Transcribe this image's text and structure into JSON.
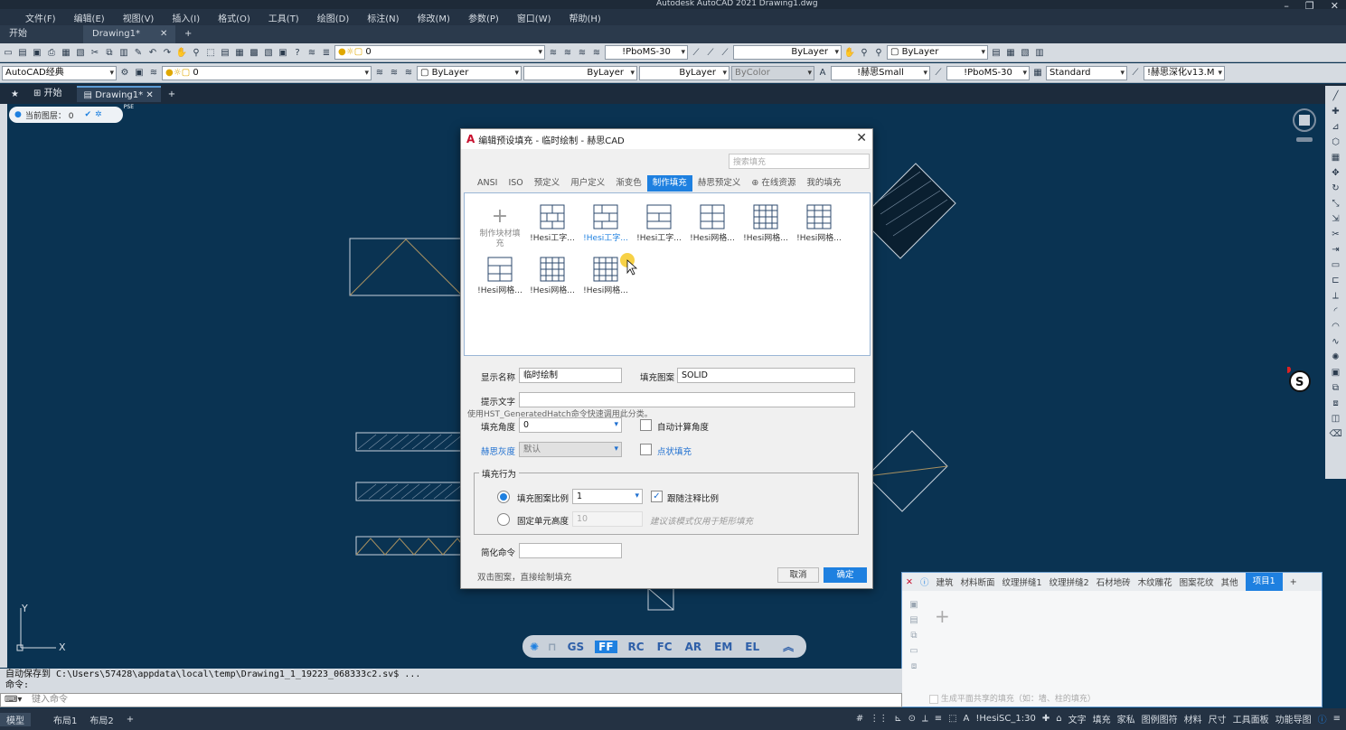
{
  "title_bar": {
    "text": "Autodesk AutoCAD 2021    Drawing1.dwg"
  },
  "menu": [
    "文件(F)",
    "编辑(E)",
    "视图(V)",
    "插入(I)",
    "格式(O)",
    "工具(T)",
    "绘图(D)",
    "标注(N)",
    "修改(M)",
    "参数(P)",
    "窗口(W)",
    "帮助(H)"
  ],
  "doc_tabs": [
    "开始",
    "Drawing1*"
  ],
  "toolbar1": {
    "layer": "0",
    "textstyle": "!PboMS-30",
    "linetype": "ByLayer",
    "color": "ByLayer"
  },
  "toolbar2": {
    "workspace": "AutoCAD经典",
    "layer": "0",
    "color": "ByLayer",
    "linetype": "ByLayer",
    "lineweight": "ByLayer",
    "plotstyle": "ByColor",
    "textstyle": "!赫思Small",
    "dimstyle": "!PboMS-30",
    "tablestyle": "Standard",
    "mleader": "!赫思深化v13.M"
  },
  "drawing_tabs": {
    "start": "开始",
    "drawing": "Drawing1*"
  },
  "layer_pill": {
    "label": "当前图层： 0",
    "pse": "PSE"
  },
  "dialog": {
    "title": "编辑预设填充 - 临时绘制 - 赫思CAD",
    "search_placeholder": "搜索填充",
    "tabs": [
      "ANSI",
      "ISO",
      "预定义",
      "用户定义",
      "渐变色",
      "制作填充",
      "赫思预定义",
      "在线资源",
      "我的填充"
    ],
    "make_block": "制作块材填充",
    "patterns": [
      "!Hesi工字...",
      "!Hesi工字...",
      "!Hesi工字...",
      "!Hesi网格...",
      "!Hesi网格...",
      "!Hesi网格...",
      "!Hesi网格...",
      "!Hesi网格...",
      "!Hesi网格..."
    ],
    "gallery_hint": "使用HST_GeneratedHatch命令快速调用此分类。",
    "display_name_label": "显示名称",
    "display_name": "临时绘制",
    "pattern_label": "填充图案",
    "pattern": "SOLID",
    "tip_label": "提示文字",
    "angle_label": "填充角度",
    "angle": "0",
    "auto_angle": "自动计算角度",
    "gray_label": "赫思灰度",
    "gray": "默认",
    "dot_fill": "点状填充",
    "behavior_title": "填充行为",
    "scale_label": "填充图案比例",
    "scale": "1",
    "follow_scale": "跟随注释比例",
    "fixed_label": "固定单元高度",
    "fixed_value": "10",
    "fixed_hint": "建议该模式仅用于矩形填充",
    "shortcut_label": "简化命令",
    "footer_hint": "双击图案，直接绘制填充",
    "cancel": "取消",
    "ok": "确定"
  },
  "quickbar": [
    "GS",
    "FF",
    "RC",
    "FC",
    "AR",
    "EM",
    "EL"
  ],
  "command": {
    "history": "自动保存到 C:\\Users\\57428\\appdata\\local\\temp\\Drawing1_1_19223_068333c2.sv$ ...",
    "prompt": "命令:",
    "placeholder": "键入命令"
  },
  "status_tabs": [
    "模型",
    "布局1",
    "布局2"
  ],
  "status_right": {
    "scale": "!HesiSC_1:30",
    "items": [
      "文字",
      "填充",
      "家私",
      "图例图符",
      "材料",
      "尺寸",
      "工具面板",
      "功能导图"
    ]
  },
  "palette": {
    "tabs": [
      "建筑",
      "材料断面",
      "纹理拼缝1",
      "纹理拼缝2",
      "石材地砖",
      "木纹雕花",
      "图案花纹",
      "其他",
      "项目1"
    ],
    "footer": "生成平面共享的填充（如：墙、柱的填充）"
  },
  "colors": {
    "accent": "#1e80e0",
    "canvas": "#0a3352"
  }
}
